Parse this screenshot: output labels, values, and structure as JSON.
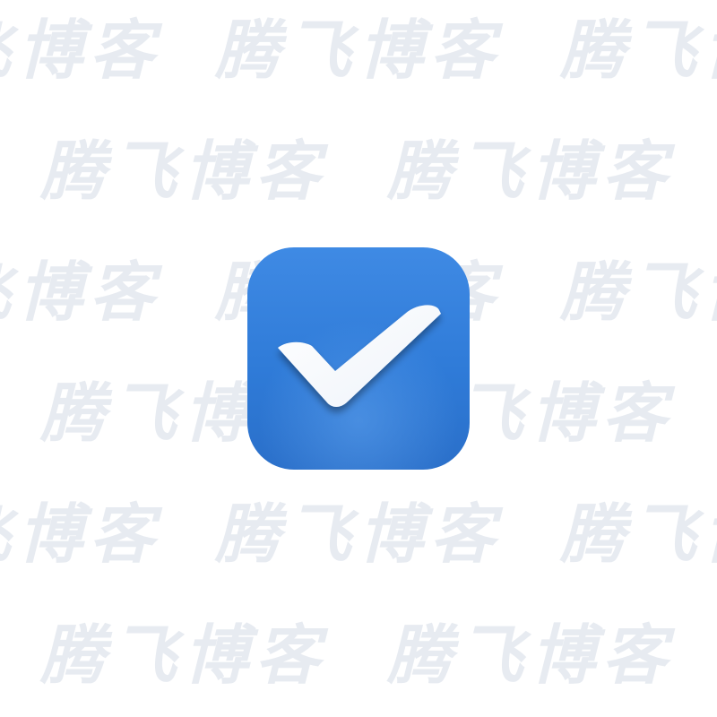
{
  "watermark": {
    "text": "腾飞博客"
  },
  "app_icon": {
    "name": "checkmark-icon",
    "background_color": "#2f7bd8",
    "mark_color": "#ffffff"
  }
}
